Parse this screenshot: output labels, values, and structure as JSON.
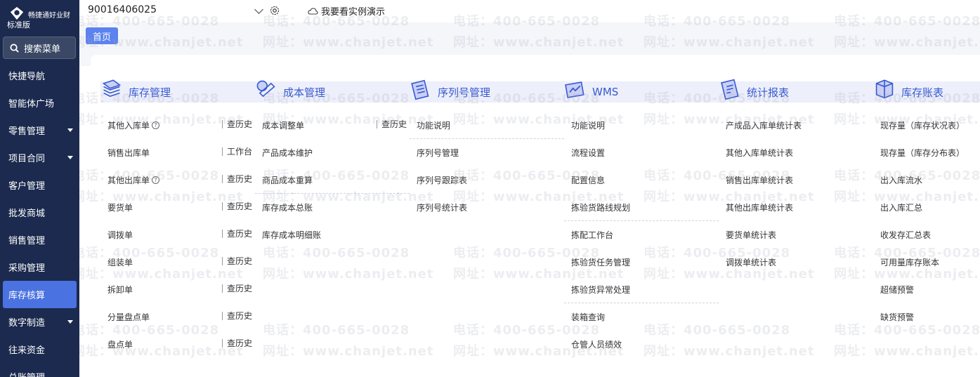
{
  "brand": {
    "name": "畅捷通好业财",
    "edition": "标准版"
  },
  "sidebar": {
    "search_label": "搜索菜单",
    "items": [
      {
        "label": "快捷导航",
        "has_submenu": false,
        "active": false
      },
      {
        "label": "智能体广场",
        "has_submenu": false,
        "active": false
      },
      {
        "label": "零售管理",
        "has_submenu": true,
        "active": false
      },
      {
        "label": "项目合同",
        "has_submenu": true,
        "active": false
      },
      {
        "label": "客户管理",
        "has_submenu": false,
        "active": false
      },
      {
        "label": "批发商城",
        "has_submenu": false,
        "active": false
      },
      {
        "label": "销售管理",
        "has_submenu": false,
        "active": false
      },
      {
        "label": "采购管理",
        "has_submenu": false,
        "active": false
      },
      {
        "label": "库存核算",
        "has_submenu": false,
        "active": true
      },
      {
        "label": "数字制造",
        "has_submenu": true,
        "active": false
      },
      {
        "label": "往来资金",
        "has_submenu": false,
        "active": false
      },
      {
        "label": "总账管理",
        "has_submenu": false,
        "active": false
      }
    ]
  },
  "topbar": {
    "account_value": "90016406025",
    "demo_label": "我要看实例演示"
  },
  "tabs": {
    "home": "首页"
  },
  "watermark": {
    "phone": "电话：400-665-0028",
    "site": "网址：www.chanjet.net"
  },
  "menu": {
    "columns": [
      {
        "title": "库存管理",
        "icon": "inventory-icon",
        "items": [
          {
            "label": "其他入库单",
            "help": true,
            "side": "查历史",
            "sep": false
          },
          {
            "label": "销售出库单",
            "help": false,
            "side": "工作台",
            "sep": false
          },
          {
            "label": "其他出库单",
            "help": true,
            "side": "查历史",
            "sep": false
          },
          {
            "label": "要货单",
            "help": false,
            "side": "查历史",
            "sep": false
          },
          {
            "label": "调拨单",
            "help": false,
            "side": "查历史",
            "sep": false
          },
          {
            "label": "组装单",
            "help": false,
            "side": "查历史",
            "sep": false
          },
          {
            "label": "拆卸单",
            "help": false,
            "side": "查历史",
            "sep": false
          },
          {
            "label": "分量盘点单",
            "help": false,
            "side": "查历史",
            "sep": false
          },
          {
            "label": "盘点单",
            "help": false,
            "side": "查历史",
            "sep": false
          }
        ]
      },
      {
        "title": "成本管理",
        "icon": "cost-icon",
        "items": [
          {
            "label": "成本调整单",
            "help": false,
            "side": "查历史",
            "sep": false
          },
          {
            "label": "产品成本维护",
            "help": false,
            "side": "",
            "sep": false
          },
          {
            "label": "商品成本重算",
            "help": false,
            "side": "",
            "sep": true
          },
          {
            "label": "库存成本总账",
            "help": false,
            "side": "",
            "sep": false
          },
          {
            "label": "库存成本明细账",
            "help": false,
            "side": "",
            "sep": false
          }
        ]
      },
      {
        "title": "序列号管理",
        "icon": "serial-icon",
        "items": [
          {
            "label": "功能说明",
            "help": false,
            "side": "",
            "sep": true
          },
          {
            "label": "序列号管理",
            "help": false,
            "side": "",
            "sep": false
          },
          {
            "label": "序列号跟踪表",
            "help": false,
            "side": "",
            "sep": false
          },
          {
            "label": "序列号统计表",
            "help": false,
            "side": "",
            "sep": false
          }
        ]
      },
      {
        "title": "WMS",
        "icon": "wms-icon",
        "items": [
          {
            "label": "功能说明",
            "help": false,
            "side": "",
            "sep": false
          },
          {
            "label": "流程设置",
            "help": false,
            "side": "",
            "sep": false
          },
          {
            "label": "配置信息",
            "help": false,
            "side": "",
            "sep": false
          },
          {
            "label": "拣验货路线规划",
            "help": false,
            "side": "",
            "sep": true
          },
          {
            "label": "拣配工作台",
            "help": false,
            "side": "",
            "sep": false
          },
          {
            "label": "拣验货任务管理",
            "help": false,
            "side": "",
            "sep": false
          },
          {
            "label": "拣验货异常处理",
            "help": false,
            "side": "",
            "sep": true
          },
          {
            "label": "装箱查询",
            "help": false,
            "side": "",
            "sep": false
          },
          {
            "label": "仓管人员绩效",
            "help": false,
            "side": "",
            "sep": false
          }
        ]
      },
      {
        "title": "统计报表",
        "icon": "report-icon",
        "items": [
          {
            "label": "产成品入库单统计表",
            "help": false,
            "side": "",
            "sep": false
          },
          {
            "label": "其他入库单统计表",
            "help": false,
            "side": "",
            "sep": false
          },
          {
            "label": "销售出库单统计表",
            "help": false,
            "side": "",
            "sep": false
          },
          {
            "label": "其他出库单统计表",
            "help": false,
            "side": "",
            "sep": false
          },
          {
            "label": "要货单统计表",
            "help": false,
            "side": "",
            "sep": false
          },
          {
            "label": "调拨单统计表",
            "help": false,
            "side": "",
            "sep": false
          }
        ]
      },
      {
        "title": "库存账表",
        "icon": "ledger-icon",
        "items": [
          {
            "label": "现存量（库存状况表）",
            "help": false,
            "side": "",
            "sep": false
          },
          {
            "label": "现存量（库存分布表）",
            "help": false,
            "side": "",
            "sep": false
          },
          {
            "label": "出入库流水",
            "help": false,
            "side": "",
            "sep": false
          },
          {
            "label": "出入库汇总",
            "help": false,
            "side": "",
            "sep": false
          },
          {
            "label": "收发存汇总表",
            "help": false,
            "side": "",
            "sep": false
          },
          {
            "label": "可用量库存账本",
            "help": false,
            "side": "",
            "sep": false
          },
          {
            "label": "超储预警",
            "help": false,
            "side": "",
            "sep": false
          },
          {
            "label": "缺货预警",
            "help": false,
            "side": "",
            "sep": false
          }
        ]
      }
    ]
  }
}
